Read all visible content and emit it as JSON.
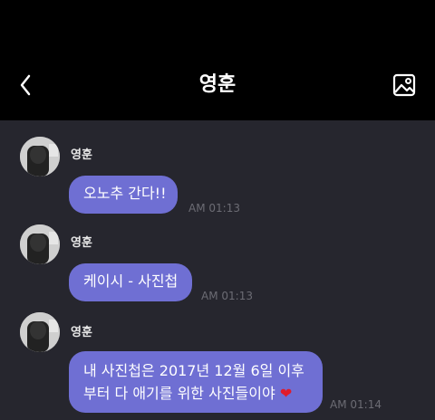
{
  "header": {
    "title": "영훈",
    "back_icon": "chevron-left-icon",
    "gallery_icon": "image-gallery-icon"
  },
  "messages": [
    {
      "sender": "영훈",
      "text": "오노추 간다!!",
      "time": "AM 01:13"
    },
    {
      "sender": "영훈",
      "text": "케이시 - 사진첩",
      "time": "AM 01:13"
    },
    {
      "sender": "영훈",
      "line1": "내 사진첩은 2017년 12월 6일 이후",
      "line2": "부터 다 애기를 위한 사진들이야",
      "emoji": "❤",
      "time": "AM 01:14"
    }
  ],
  "colors": {
    "bubble": "#6f6fd3",
    "background": "#26262e",
    "header": "#000000",
    "heart": "#e01b2a"
  }
}
